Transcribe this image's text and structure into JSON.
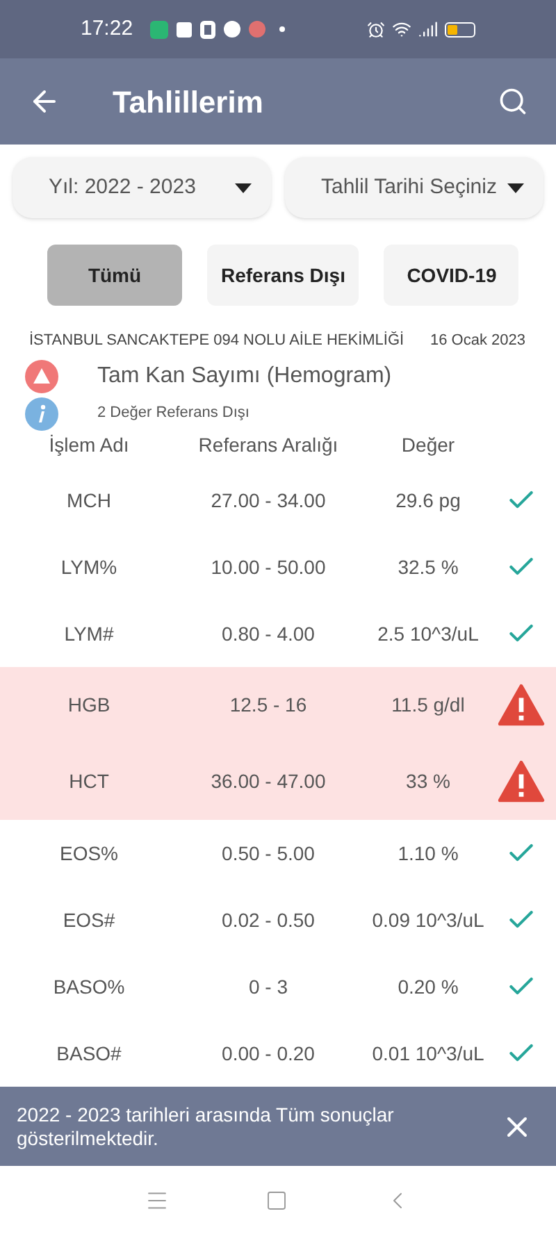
{
  "status_bar": {
    "time": "17:22"
  },
  "app_bar": {
    "title": "Tahlillerim"
  },
  "filters": [
    {
      "label": "Yıl: 2022 - 2023"
    },
    {
      "label": "Tahlil Tarihi Seçiniz"
    }
  ],
  "tabs": [
    {
      "label": "Tümü",
      "selected": true
    },
    {
      "label": "Referans Dışı",
      "selected": false
    },
    {
      "label": "COVID-19",
      "selected": false
    }
  ],
  "report": {
    "institution": "İSTANBUL SANCAKTEPE 094 NOLU AİLE HEKİMLİĞİ",
    "date": "16 Ocak 2023",
    "test_name": "Tam Kan Sayımı (Hemogram)",
    "summary": "2 Değer Referans Dışı"
  },
  "table": {
    "columns": [
      "İşlem Adı",
      "Referans Aralığı",
      "Değer"
    ],
    "rows": [
      {
        "name": "MCH",
        "range": "27.00 - 34.00",
        "value": "29.6 pg",
        "kind": "normal"
      },
      {
        "name": "LYM%",
        "range": "10.00 - 50.00",
        "value": "32.5 %",
        "kind": "normal"
      },
      {
        "name": "LYM#",
        "range": "0.80 - 4.00",
        "value": "2.5 10^3/uL",
        "kind": "normal"
      },
      {
        "name": "HGB",
        "range": "12.5 - 16",
        "value": "11.5 g/dl",
        "kind": "out"
      },
      {
        "name": "HCT",
        "range": "36.00 - 47.00",
        "value": "33 %",
        "kind": "out"
      },
      {
        "name": "EOS%",
        "range": "0.50 - 5.00",
        "value": "1.10 %",
        "kind": "normal"
      },
      {
        "name": "EOS#",
        "range": "0.02 - 0.50",
        "value": "0.09 10^3/uL",
        "kind": "normal"
      },
      {
        "name": "BASO%",
        "range": "0 - 3",
        "value": "0.20 %",
        "kind": "normal"
      },
      {
        "name": "BASO#",
        "range": "0.00 - 0.20",
        "value": "0.01 10^3/uL",
        "kind": "normal"
      }
    ]
  },
  "snackbar": {
    "message": "2022 - 2023 tarihleri arasında Tüm sonuçlar gösterilmektedir."
  }
}
